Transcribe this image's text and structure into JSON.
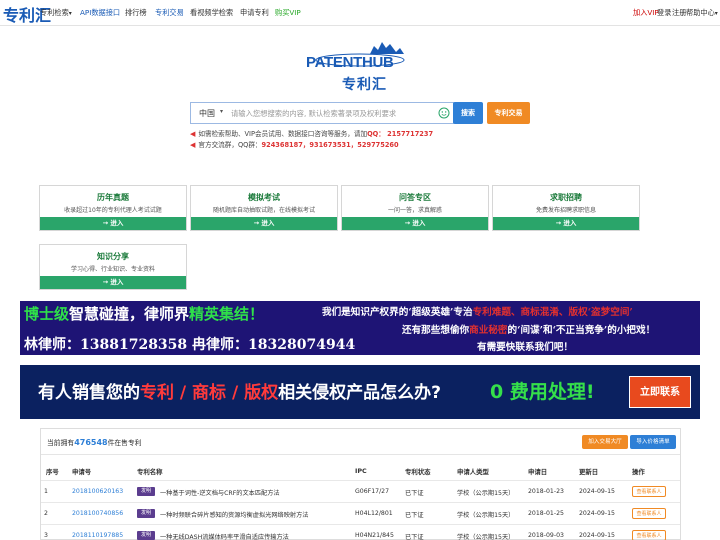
{
  "nav": {
    "logo": "专利汇",
    "items": [
      {
        "label": "专利检索",
        "caret": "▾",
        "style": "normal"
      },
      {
        "label": "API数据接口",
        "style": "blue"
      },
      {
        "label": "排行榜",
        "style": "normal"
      },
      {
        "label": "专利交易",
        "style": "blue"
      },
      {
        "label": "看视频学检索",
        "style": "normal"
      },
      {
        "label": "申请专利",
        "style": "normal"
      },
      {
        "label": "购买VIP",
        "style": "green"
      }
    ],
    "right": {
      "join_vip": "加入VIP",
      "login": "登录",
      "register": "注册",
      "help": "帮助中心",
      "help_caret": "▾"
    }
  },
  "brand": {
    "en": "PATENTHUB",
    "cn": "专利汇"
  },
  "search": {
    "country": "中国",
    "caret": "▾",
    "placeholder": "请输入您想搜索的内容, 默认检索著录项及权利要求",
    "search_button": "搜索",
    "trade_button": "专利交易"
  },
  "notices": [
    {
      "prefix": "如需检索帮助、VIP会员试用、数据接口咨询等服务，请加",
      "highlight": "QQ： 2157717237"
    },
    {
      "prefix": "官方交流群，QQ群：",
      "highlight": "924368187，931673531，529775260"
    }
  ],
  "cards": [
    {
      "title": "历年真题",
      "desc": "收录超过10年的专利代理人考试试题",
      "action": "进入"
    },
    {
      "title": "模拟考试",
      "desc": "随机题库自动抽取试题，在线模拟考试",
      "action": "进入"
    },
    {
      "title": "问答专区",
      "desc": "一问一答，求真解惑",
      "action": "进入"
    },
    {
      "title": "求职招聘",
      "desc": "免费发布招聘求职信息",
      "action": "进入"
    },
    {
      "title": "知识分享",
      "desc": "学习心得、行业知识、专业资料",
      "action": "进入"
    }
  ],
  "banner_lawyers": {
    "line1_a": "博士级",
    "line1_b": "智慧碰撞，律师界",
    "line1_c": "精英集结！",
    "line2": "林律师：13881728358    冉律师：18328074944",
    "right1_a": "我们是知识产权界的‘超级英雄’专治",
    "right1_b": "专利难题、商标混淆、版权‘盗梦空间’",
    "right2_a": "还有那些想偷你",
    "right2_b": "商业秘密",
    "right2_c": "的‘间谍’和‘不正当竞争’的小把戏！",
    "right3": "有需要快联系我们吧！"
  },
  "banner_infringe": {
    "text_a": "有人销售您的",
    "text_b": "专利 / 商标 / 版权",
    "text_c": "相关侵权产品怎么办?",
    "free": "0 费用处理!",
    "button": "立即联系"
  },
  "listing": {
    "count_prefix": "当前拥有",
    "count": "476548",
    "count_suffix": "件在售专利",
    "join_button": "加入交易大厅",
    "import_button": "导入价格清单",
    "headers": [
      "序号",
      "申请号",
      "专利名称",
      "IPC",
      "专利状态",
      "申请人类型",
      "申请日",
      "更新日",
      "操作"
    ],
    "rows": [
      {
        "no": "1",
        "app_no": "2018100620163",
        "tag": "发明",
        "name": "一种基于词性-逆文档与CRF的文本匹配方法",
        "ipc": "G06F17/27",
        "status": "已下证",
        "applicant": "学校（公示期15天）",
        "app_date": "2018-01-23",
        "update": "2024-09-15",
        "action": "查看联系人"
      },
      {
        "no": "2",
        "app_no": "2018100740856",
        "tag": "发明",
        "name": "一种时频联合碎片感知的资源均衡虚拟光网络映射方法",
        "ipc": "H04L12/801",
        "status": "已下证",
        "applicant": "学校（公示期15天）",
        "app_date": "2018-01-25",
        "update": "2024-09-15",
        "action": "查看联系人"
      },
      {
        "no": "3",
        "app_no": "2018110197885",
        "tag": "发明",
        "name": "一种无线DASH流媒体码率平滑自适应传输方法",
        "ipc": "H04N21/845",
        "status": "已下证",
        "applicant": "学校（公示期15天）",
        "app_date": "2018-09-03",
        "update": "2024-09-15",
        "action": "查看联系人"
      }
    ]
  }
}
